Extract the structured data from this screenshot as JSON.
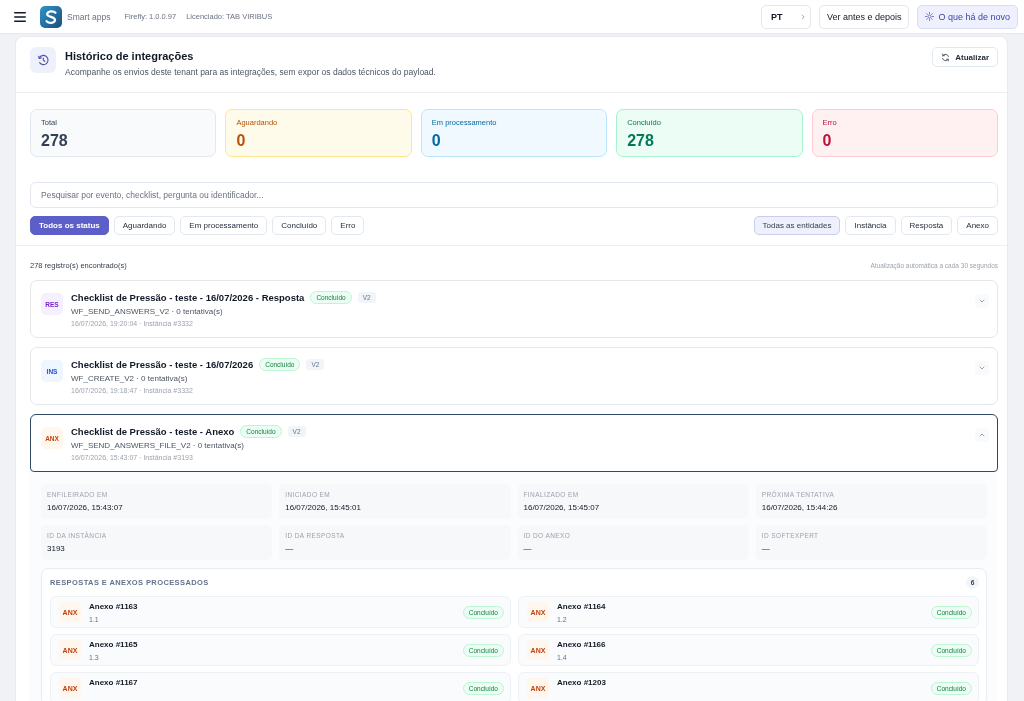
{
  "topbar": {
    "app_name": "Smart apps",
    "version": "Firefly: 1.0.0.97",
    "license": "Licenciado: TAB VIRIBUS",
    "language": "PT",
    "buttons": [
      {
        "label": "Ver antes e depois",
        "kind": "plain"
      },
      {
        "label": "O que há de novo",
        "kind": "highlight"
      }
    ]
  },
  "header": {
    "title": "Histórico de integrações",
    "subtitle": "Acompanhe os envios deste tenant para as integrações, sem expor os dados técnicos do payload.",
    "refresh_button": "Atualizar"
  },
  "stats": [
    {
      "label": "Total",
      "value": "278",
      "kind": "total"
    },
    {
      "label": "Aguardando",
      "value": "0",
      "kind": "waiting"
    },
    {
      "label": "Em processamento",
      "value": "0",
      "kind": "processing"
    },
    {
      "label": "Concluído",
      "value": "278",
      "kind": "done"
    },
    {
      "label": "Erro",
      "value": "0",
      "kind": "error"
    }
  ],
  "search": {
    "placeholder": "Pesquisar por evento, checklist, pergunta ou identificador..."
  },
  "status_filters": [
    {
      "label": "Todos os status",
      "selected": true
    },
    {
      "label": "Aguardando",
      "selected": false
    },
    {
      "label": "Em processamento",
      "selected": false
    },
    {
      "label": "Concluído",
      "selected": false
    },
    {
      "label": "Erro",
      "selected": false
    }
  ],
  "entity_filters": [
    {
      "label": "Todas as entidades",
      "selected": true
    },
    {
      "label": "Instância",
      "selected": false
    },
    {
      "label": "Resposta",
      "selected": false
    },
    {
      "label": "Anexo",
      "selected": false
    }
  ],
  "results": {
    "count": "278 registro(s) encontrado(s)",
    "auto_refresh": "Atualização automática a cada 30 segundos"
  },
  "records": [
    {
      "kind": "resposta",
      "badge": "RES",
      "title": "Checklist de Pressão - teste - 16/07/2026 - Resposta",
      "status": "Concluído",
      "version": "V2",
      "event": "WF_SEND_ANSWERS_V2 · 0 tentativa(s)",
      "meta": "16/07/2026, 19:20:04 · Instância #3332",
      "expanded": false
    },
    {
      "kind": "instancia",
      "badge": "INS",
      "title": "Checklist de Pressão - teste - 16/07/2026",
      "status": "Concluído",
      "version": "V2",
      "event": "WF_CREATE_V2 · 0 tentativa(s)",
      "meta": "16/07/2026, 19:18:47 · Instância #3332",
      "expanded": false
    },
    {
      "kind": "anexo",
      "badge": "ANX",
      "title": "Checklist de Pressão - teste - Anexo",
      "status": "Concluído",
      "version": "V2",
      "event": "WF_SEND_ANSWERS_FILE_V2 · 0 tentativa(s)",
      "meta": "16/07/2026, 15:43:07 · Instância #3193",
      "expanded": true,
      "details": [
        {
          "label": "ENFILEIRADO EM",
          "value": "16/07/2026, 15:43:07"
        },
        {
          "label": "INICIADO EM",
          "value": "16/07/2026, 15:45:01"
        },
        {
          "label": "FINALIZADO EM",
          "value": "16/07/2026, 15:45:07"
        },
        {
          "label": "PRÓXIMA TENTATIVA",
          "value": "16/07/2026, 15:44:26"
        },
        {
          "label": "ID DA INSTÂNCIA",
          "value": "3193"
        },
        {
          "label": "ID DA RESPOSTA",
          "value": "—"
        },
        {
          "label": "ID DO ANEXO",
          "value": "—"
        },
        {
          "label": "ID SOFTEXPERT",
          "value": "—"
        }
      ],
      "processed": {
        "title": "RESPOSTAS E ANEXOS PROCESSADOS",
        "count": "6",
        "items": [
          {
            "kind": "anexo",
            "badge": "ANX",
            "title": "Anexo #1163",
            "subtitle": "1.1",
            "status": "Concluído"
          },
          {
            "kind": "anexo",
            "badge": "ANX",
            "title": "Anexo #1164",
            "subtitle": "1.2",
            "status": "Concluído"
          },
          {
            "kind": "anexo",
            "badge": "ANX",
            "title": "Anexo #1165",
            "subtitle": "1.3",
            "status": "Concluído"
          },
          {
            "kind": "anexo",
            "badge": "ANX",
            "title": "Anexo #1166",
            "subtitle": "1.4",
            "status": "Concluído"
          },
          {
            "kind": "anexo",
            "badge": "ANX",
            "title": "Anexo #1167",
            "status": "Concluído"
          },
          {
            "kind": "anexo",
            "badge": "ANX",
            "title": "Anexo #1203",
            "status": "Concluído"
          }
        ]
      }
    }
  ]
}
